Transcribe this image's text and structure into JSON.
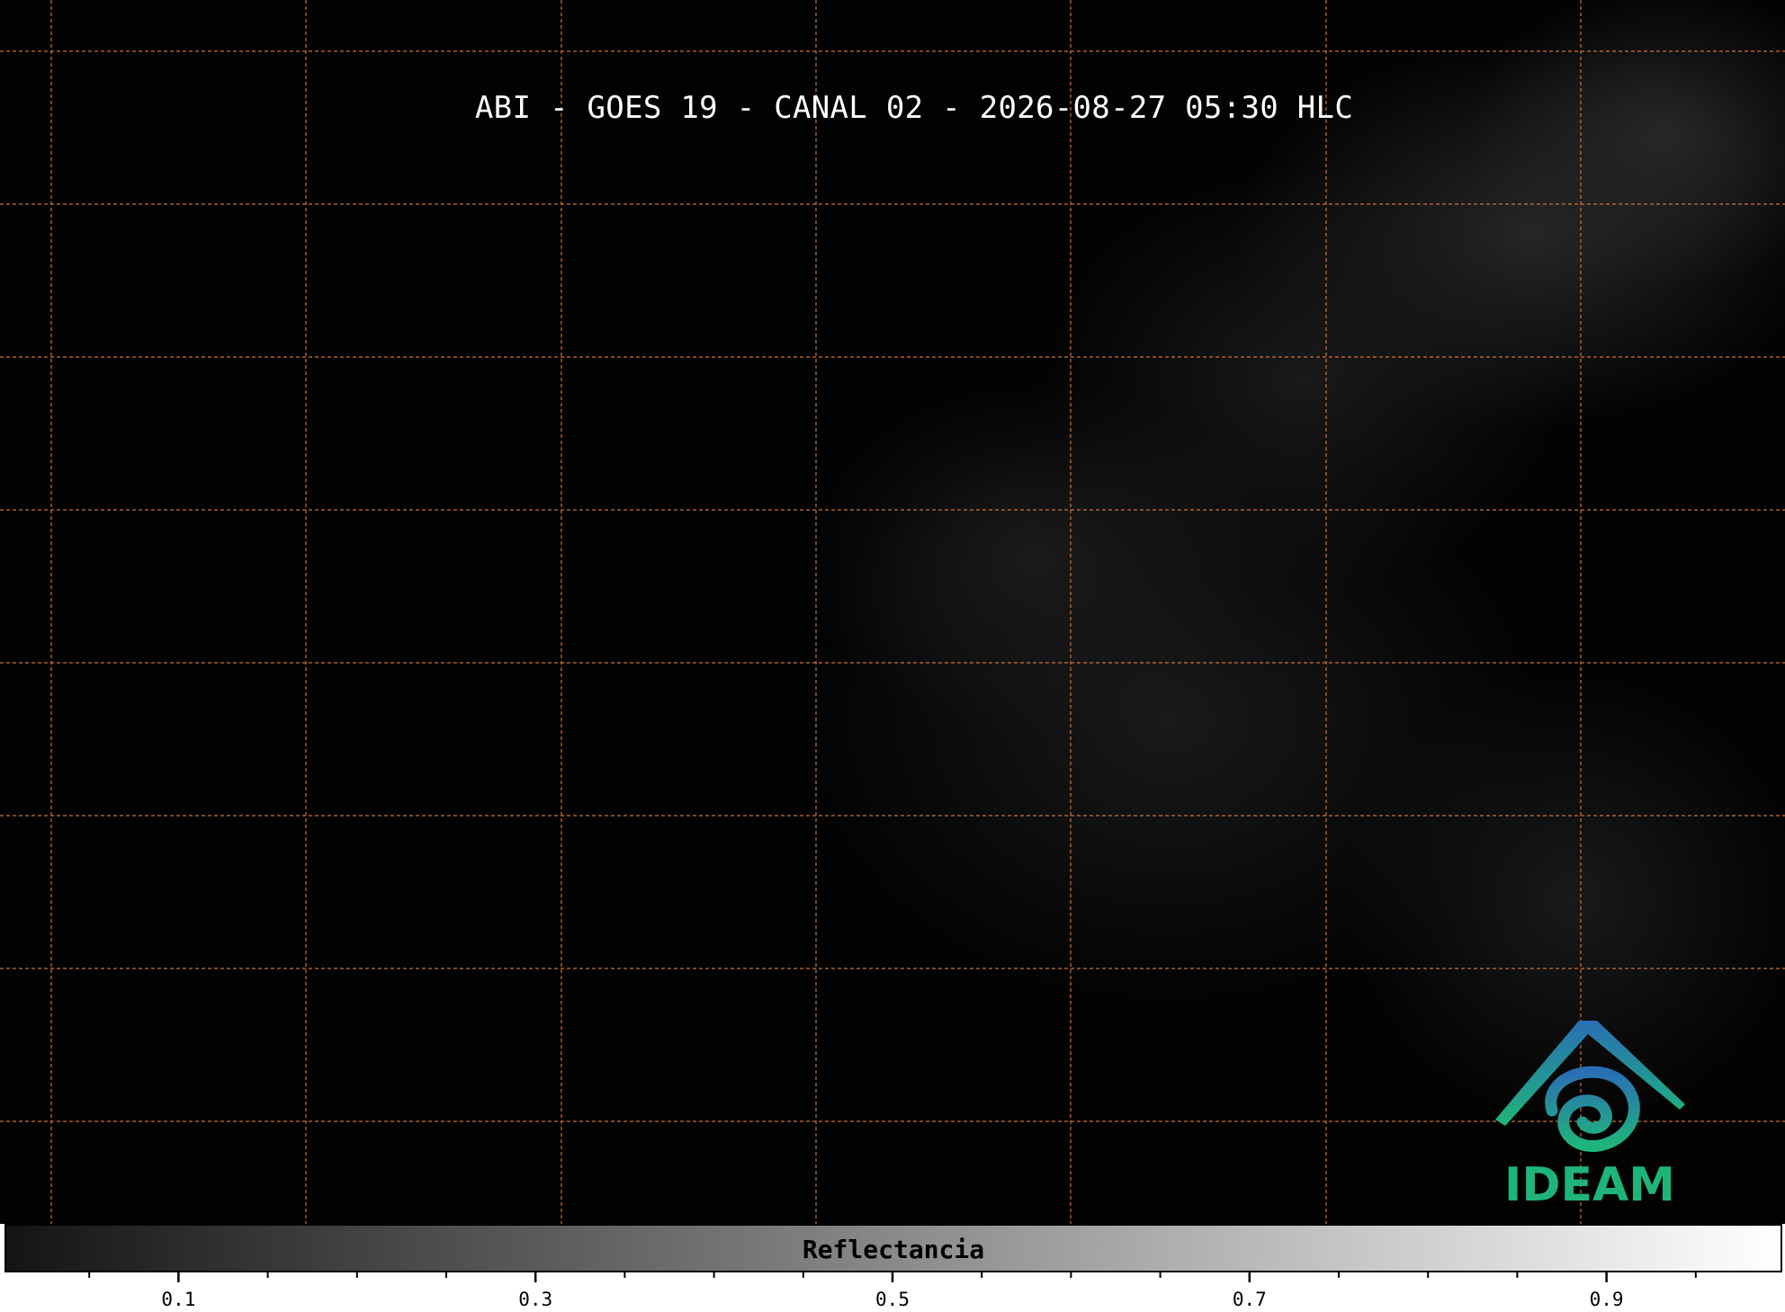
{
  "title": "ABI - GOES 19 - CANAL 02 - 2026-08-27 05:30 HLC",
  "logo": {
    "text": "IDEAM",
    "color_top": "#2a6fb5",
    "color_bottom": "#1fb57a"
  },
  "grid": {
    "color": "#c8733a",
    "style": "dashed"
  },
  "colorbar": {
    "label": "Reflectancia",
    "range": [
      0,
      1
    ],
    "colors": [
      "#141414",
      "#ffffff"
    ],
    "major_ticks": [
      {
        "value": 0.1,
        "label": "0.1"
      },
      {
        "value": 0.3,
        "label": "0.3"
      },
      {
        "value": 0.5,
        "label": "0.5"
      },
      {
        "value": 0.7,
        "label": "0.7"
      },
      {
        "value": 0.9,
        "label": "0.9"
      }
    ],
    "minor_ticks": [
      0.05,
      0.15,
      0.2,
      0.25,
      0.35,
      0.4,
      0.45,
      0.55,
      0.6,
      0.65,
      0.75,
      0.8,
      0.85,
      0.95
    ]
  }
}
